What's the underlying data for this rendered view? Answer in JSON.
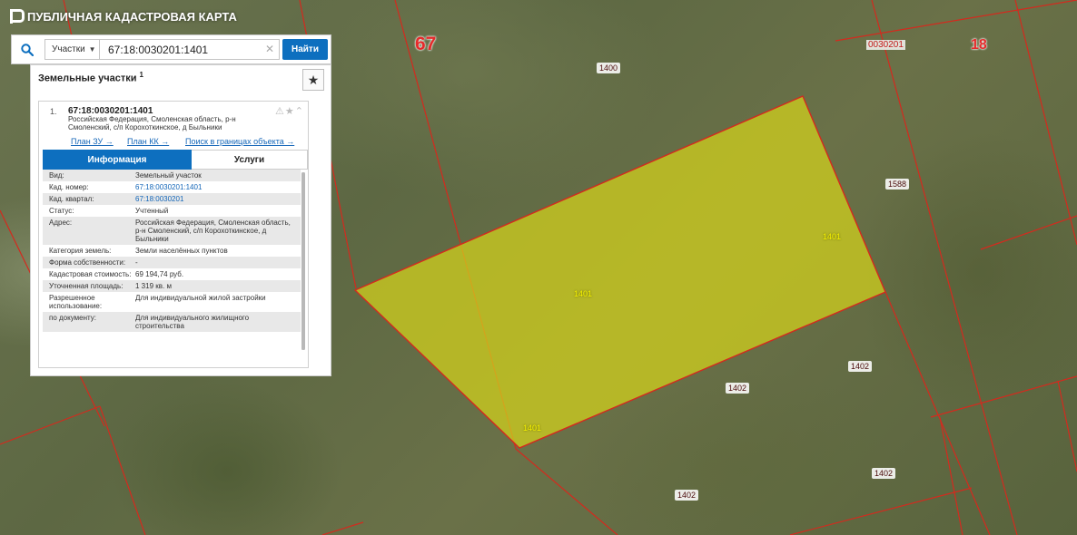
{
  "app": {
    "title": "ПУБЛИЧНАЯ КАДАСТРОВАЯ КАРТА"
  },
  "search": {
    "category": "Участки",
    "query": "67:18:0030201:1401",
    "button_label": "Найти"
  },
  "results": {
    "header": "Земельные участки",
    "count": "1",
    "item": {
      "index": "1.",
      "cad_number": "67:18:0030201:1401",
      "address": "Российская Федерация, Смоленская область, р-н Смоленский, с/п Корохоткинское, д Быльники",
      "links": {
        "plan_zu": "План ЗУ →",
        "plan_kk": "План КК →",
        "search_bounds": "Поиск в границах объекта →"
      },
      "tabs": {
        "info": "Информация",
        "services": "Услуги"
      },
      "rows": [
        {
          "label": "Вид:",
          "value": "Земельный участок",
          "link": false
        },
        {
          "label": "Кад. номер:",
          "value": "67:18:0030201:1401",
          "link": true
        },
        {
          "label": "Кад. квартал:",
          "value": "67:18:0030201",
          "link": true
        },
        {
          "label": "Статус:",
          "value": "Учтенный",
          "link": false
        },
        {
          "label": "Адрес:",
          "value": "Российская Федерация, Смоленская область, р-н Смоленский, с/п Корохоткинское, д Быльники",
          "link": false
        },
        {
          "label": "Категория земель:",
          "value": "Земли населённых пунктов",
          "link": false
        },
        {
          "label": "Форма собственности:",
          "value": "-",
          "link": false
        },
        {
          "label": "Кадастровая стоимость:",
          "value": "69 194,74 руб.",
          "link": false
        },
        {
          "label": "Уточненная площадь:",
          "value": "1 319 кв. м",
          "link": false
        },
        {
          "label": "Разрешенное использование:",
          "value": "Для индивидуальной жилой застройки",
          "link": false
        },
        {
          "label": "по документу:",
          "value": "Для индивидуального жилищного строительства",
          "link": false
        }
      ]
    }
  },
  "map": {
    "district_label": "67",
    "quarter_label": "18",
    "quarter_code": "0030201",
    "parcel_labels": [
      "1400",
      "1588",
      "1401",
      "1401",
      "1401",
      "1402",
      "1402",
      "1402",
      "1402"
    ],
    "colors": {
      "boundary": "#d42a1e",
      "selected_fill": "#d4d21c",
      "accent": "#0d6fbf"
    }
  }
}
